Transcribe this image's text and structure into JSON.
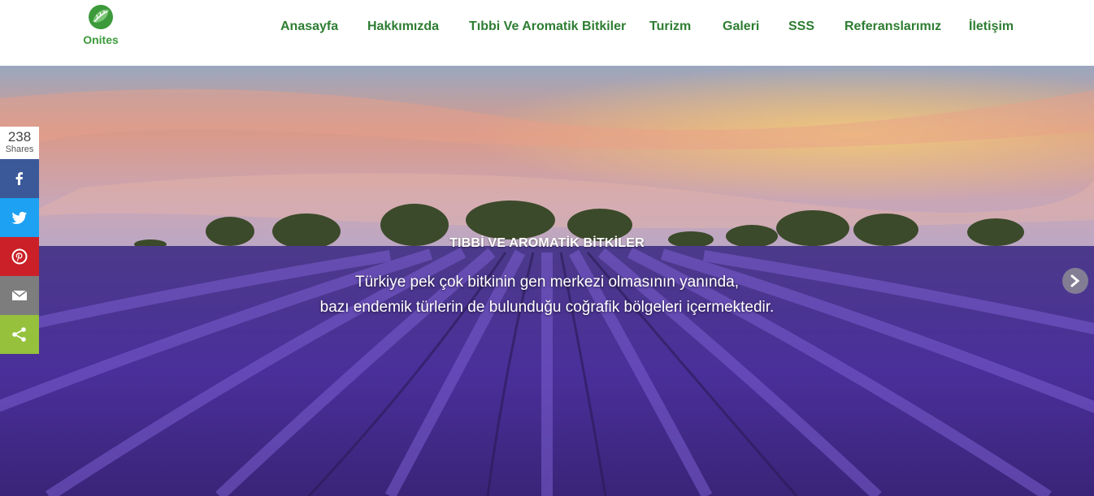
{
  "brand": {
    "name": "Onites",
    "accent": "#3c9a3a",
    "icon": "leaf-globe-logo"
  },
  "nav": {
    "items": [
      {
        "id": "anasayfa",
        "label": "Anasayfa"
      },
      {
        "id": "hakkimizda",
        "label": "Hakkımızda"
      },
      {
        "id": "tibbi",
        "label": "Tıbbi Ve Aromatik Bitkiler"
      },
      {
        "id": "turizm",
        "label": "Turizm"
      },
      {
        "id": "galeri",
        "label": "Galeri"
      },
      {
        "id": "sss",
        "label": "SSS"
      },
      {
        "id": "referans",
        "label": "Referanslarımız"
      },
      {
        "id": "iletisim",
        "label": "İletişim"
      }
    ],
    "color": "#2e7d32"
  },
  "hero": {
    "title": "TIBBİ VE AROMATİK BİTKİLER",
    "line1": "Türkiye pek çok bitkinin gen merkezi olmasının yanında,",
    "line2": "bazı endemik türlerin de bulunduğu coğrafik bölgeleri içermektedir.",
    "next_icon": "chevron-right-icon"
  },
  "share": {
    "count": "238",
    "label": "Shares",
    "buttons": [
      {
        "id": "facebook",
        "icon": "facebook-icon",
        "color": "#3b5998"
      },
      {
        "id": "twitter",
        "icon": "twitter-icon",
        "color": "#1da1f2"
      },
      {
        "id": "pinterest",
        "icon": "pinterest-icon",
        "color": "#cb2027"
      },
      {
        "id": "email",
        "icon": "email-icon",
        "color": "#7d7d7d"
      },
      {
        "id": "share",
        "icon": "share-icon",
        "color": "#95c13d"
      }
    ]
  }
}
